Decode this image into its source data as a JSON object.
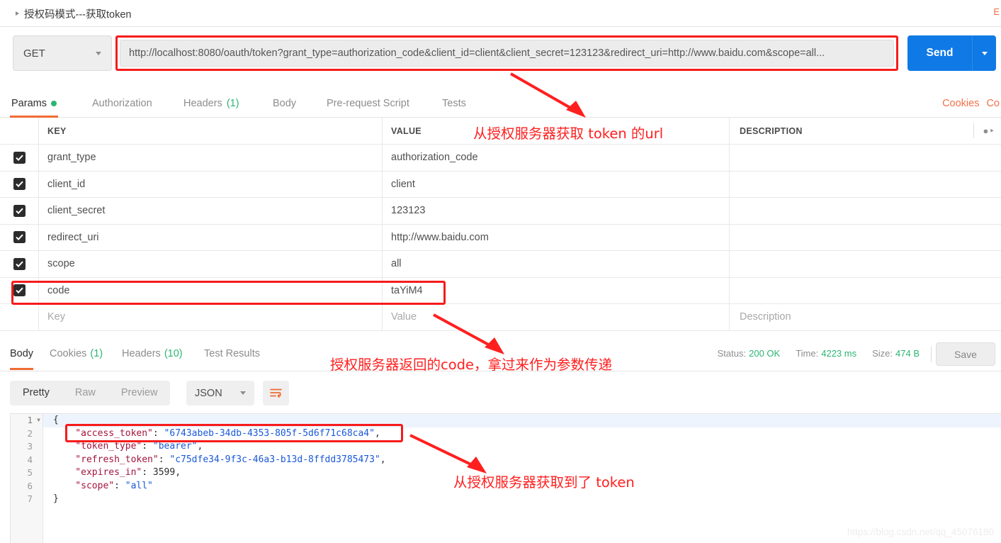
{
  "window": {
    "request_tab_title": "授权码模式---获取token",
    "tab_close_label": "E",
    "watermark": "https://blog.csdn.net/qq_45076180"
  },
  "url_bar": {
    "method": "GET",
    "url": "http://localhost:8080/oauth/token?grant_type=authorization_code&client_id=client&client_secret=123123&redirect_uri=http://www.baidu.com&scope=all...",
    "send_label": "Send"
  },
  "request_tabs": [
    {
      "label": "Params",
      "badge": "",
      "dot": true,
      "active": true
    },
    {
      "label": "Authorization",
      "badge": "",
      "dot": false,
      "active": false
    },
    {
      "label": "Headers",
      "badge": "(1)",
      "dot": false,
      "active": false
    },
    {
      "label": "Body",
      "badge": "",
      "dot": false,
      "active": false
    },
    {
      "label": "Pre-request Script",
      "badge": "",
      "dot": false,
      "active": false
    },
    {
      "label": "Tests",
      "badge": "",
      "dot": false,
      "active": false
    }
  ],
  "request_tabs_right": [
    {
      "label": "Cookies"
    },
    {
      "label": "Co"
    }
  ],
  "params_table": {
    "headers": {
      "key": "KEY",
      "value": "VALUE",
      "description": "DESCRIPTION"
    },
    "rows": [
      {
        "checked": true,
        "key": "grant_type",
        "value": "authorization_code",
        "description": ""
      },
      {
        "checked": true,
        "key": "client_id",
        "value": "client",
        "description": ""
      },
      {
        "checked": true,
        "key": "client_secret",
        "value": "123123",
        "description": ""
      },
      {
        "checked": true,
        "key": "redirect_uri",
        "value": "http://www.baidu.com",
        "description": ""
      },
      {
        "checked": true,
        "key": "scope",
        "value": "all",
        "description": ""
      },
      {
        "checked": true,
        "key": "code",
        "value": "taYiM4",
        "description": ""
      }
    ],
    "placeholder_row": {
      "key": "Key",
      "value": "Value",
      "description": "Description"
    },
    "bulk_edit_icon": "ellipsis-icon"
  },
  "response": {
    "tabs": [
      {
        "label": "Body",
        "badge": "",
        "active": true
      },
      {
        "label": "Cookies",
        "badge": "(1)",
        "active": false
      },
      {
        "label": "Headers",
        "badge": "(10)",
        "active": false
      },
      {
        "label": "Test Results",
        "badge": "",
        "active": false
      }
    ],
    "status_label": "Status:",
    "status_value": "200 OK",
    "time_label": "Time:",
    "time_value": "4223 ms",
    "size_label": "Size:",
    "size_value": "474 B",
    "save_label": "Save",
    "view_modes": [
      {
        "label": "Pretty",
        "active": true
      },
      {
        "label": "Raw",
        "active": false
      },
      {
        "label": "Preview",
        "active": false
      }
    ],
    "format": "JSON",
    "wrap_icon": "wrap-lines-icon",
    "body_lines": [
      {
        "num": "1",
        "foldable": true,
        "parts": [
          {
            "t": "p",
            "v": "{"
          }
        ],
        "highlight": true
      },
      {
        "num": "2",
        "foldable": false,
        "parts": [
          {
            "t": "k",
            "v": "    \"access_token\""
          },
          {
            "t": "p",
            "v": ": "
          },
          {
            "t": "s",
            "v": "\"6743abeb-34db-4353-805f-5d6f71c68ca4\""
          },
          {
            "t": "p",
            "v": ","
          }
        ],
        "highlight": false
      },
      {
        "num": "3",
        "foldable": false,
        "parts": [
          {
            "t": "k",
            "v": "    \"token_type\""
          },
          {
            "t": "p",
            "v": ": "
          },
          {
            "t": "s",
            "v": "\"bearer\""
          },
          {
            "t": "p",
            "v": ","
          }
        ],
        "highlight": false
      },
      {
        "num": "4",
        "foldable": false,
        "parts": [
          {
            "t": "k",
            "v": "    \"refresh_token\""
          },
          {
            "t": "p",
            "v": ": "
          },
          {
            "t": "s",
            "v": "\"c75dfe34-9f3c-46a3-b13d-8ffdd3785473\""
          },
          {
            "t": "p",
            "v": ","
          }
        ],
        "highlight": false
      },
      {
        "num": "5",
        "foldable": false,
        "parts": [
          {
            "t": "k",
            "v": "    \"expires_in\""
          },
          {
            "t": "p",
            "v": ": "
          },
          {
            "t": "n",
            "v": "3599"
          },
          {
            "t": "p",
            "v": ","
          }
        ],
        "highlight": false
      },
      {
        "num": "6",
        "foldable": false,
        "parts": [
          {
            "t": "k",
            "v": "    \"scope\""
          },
          {
            "t": "p",
            "v": ": "
          },
          {
            "t": "s",
            "v": "\"all\""
          }
        ],
        "highlight": false
      },
      {
        "num": "7",
        "foldable": false,
        "parts": [
          {
            "t": "p",
            "v": "}"
          }
        ],
        "highlight": false
      }
    ]
  },
  "annotations": [
    {
      "id": "url-note",
      "text": "从授权服务器获取 token 的url"
    },
    {
      "id": "code-note",
      "text": "授权服务器返回的code，拿过来作为参数传递"
    },
    {
      "id": "token-note",
      "text": "从授权服务器获取到了 token"
    }
  ]
}
